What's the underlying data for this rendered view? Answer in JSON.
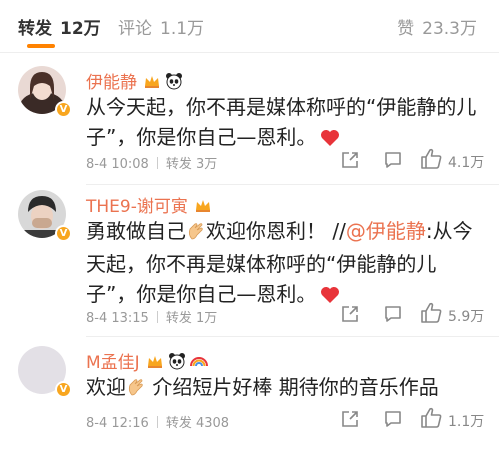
{
  "tabs": {
    "repost": {
      "label": "转发",
      "count": "12万"
    },
    "comment": {
      "label": "评论",
      "count": "1.1万"
    },
    "likes": {
      "label": "赞",
      "count": "23.3万"
    }
  },
  "comments": [
    {
      "name": "伊能静",
      "text": "从今天起，你不再是媒体称呼的“伊能静的儿子”，你是你自己—恩利。",
      "date": "8-4 10:08",
      "repost": "转发 3万",
      "likes": "4.1万"
    },
    {
      "name": "THE9-谢可寅",
      "text_a": "勇敢做自己",
      "text_b": "欢迎你恩利！ //",
      "mention": "@伊能静",
      "text_c": ":从今天起，你不再是媒体称呼的“伊能静的儿子”，你是你自己—恩利。",
      "date": "8-4 13:15",
      "repost": "转发 1万",
      "likes": "5.9万"
    },
    {
      "name": "M孟佳J",
      "text_a": "欢迎",
      "text_b": " 介绍短片好棒 期待你的音乐作品",
      "date": "8-4 12:16",
      "repost": "转发 4308",
      "likes": "1.1万"
    }
  ],
  "colors": {
    "accent": "#ff8200",
    "name": "#eb7350",
    "badge": "#f8a61f",
    "heart": "#e8343a"
  }
}
